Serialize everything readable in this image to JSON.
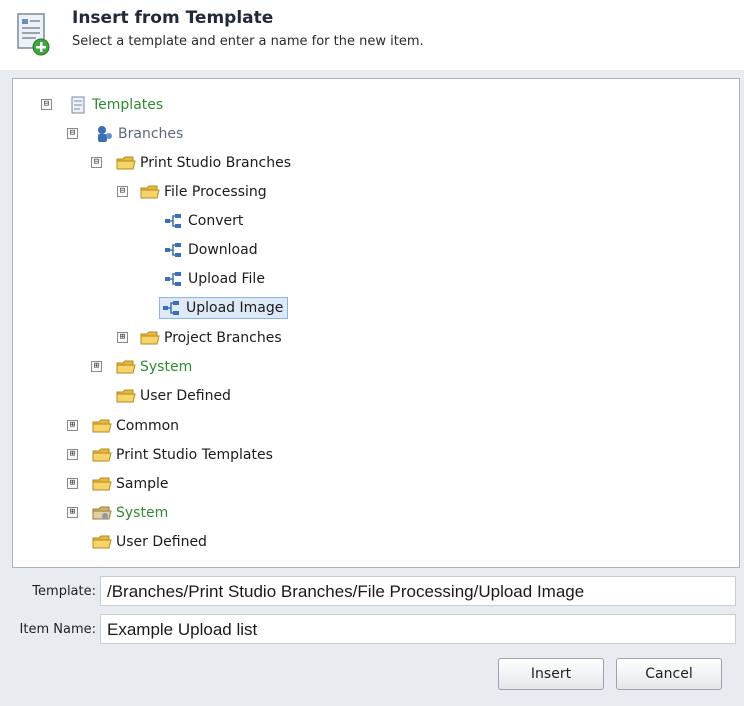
{
  "header": {
    "title": "Insert from Template",
    "subtitle": "Select a template and enter a name for the new item.",
    "icon": "template-document-icon"
  },
  "tree": [
    {
      "label": "Templates",
      "toggle": "⊟"
    },
    {
      "label": "Branches",
      "toggle": "⊟"
    },
    {
      "label": "Print Studio Branches",
      "toggle": "⊟"
    },
    {
      "label": "File Processing",
      "toggle": "⊟"
    },
    {
      "label": "Convert"
    },
    {
      "label": "Download"
    },
    {
      "label": "Upload File"
    },
    {
      "label": "Upload Image",
      "selected": true
    },
    {
      "label": "Project Branches",
      "toggle": "⊞"
    },
    {
      "label": "System",
      "toggle": "⊞"
    },
    {
      "label": "User Defined"
    },
    {
      "label": "Common",
      "toggle": "⊞"
    },
    {
      "label": "Print Studio Templates",
      "toggle": "⊞"
    },
    {
      "label": "Sample",
      "toggle": "⊞"
    },
    {
      "label": "System",
      "toggle": "⊞"
    },
    {
      "label": "User Defined"
    }
  ],
  "form": {
    "template_label": "Template:",
    "template_value": "/Branches/Print Studio Branches/File Processing/Upload Image",
    "item_name_label": "Item Name:",
    "item_name_value": "Example Upload list"
  },
  "buttons": {
    "insert": "Insert",
    "cancel": "Cancel"
  },
  "colors": {
    "green_label": "#2e8b2e",
    "selection": "#dde9f7",
    "panel_bg": "#e8ecf0"
  }
}
